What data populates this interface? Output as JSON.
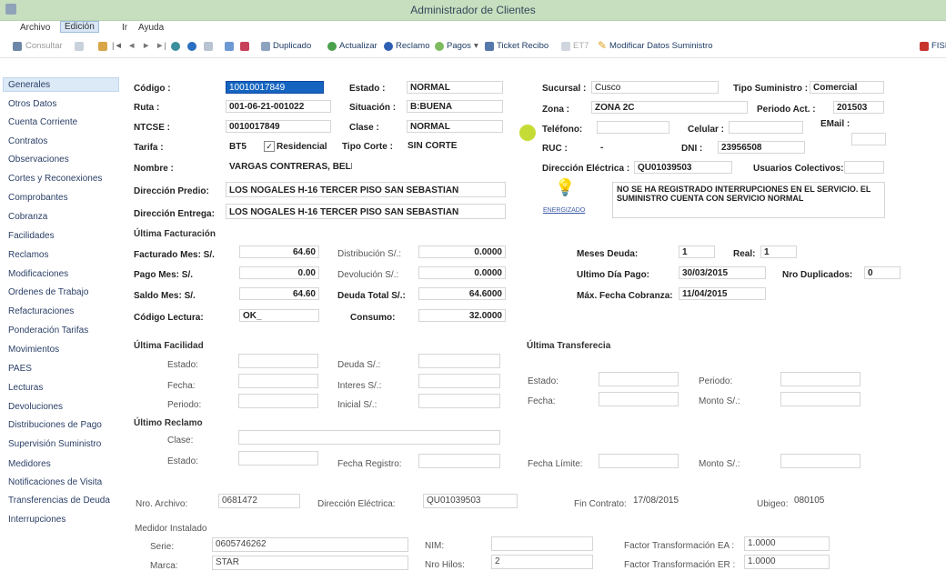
{
  "window": {
    "title": "Administrador de Clientes"
  },
  "menu": [
    "Archivo",
    "Edición",
    "Ir",
    "Ayuda"
  ],
  "toolbar": {
    "consultar": "Consultar",
    "duplicado": "Duplicado",
    "actualizar": "Actualizar",
    "reclamo": "Reclamo",
    "pagos": "Pagos",
    "ticket": "Ticket Recibo",
    "et7": "ET7",
    "modificar": "Modificar Datos Suministro",
    "fisi": "FISI"
  },
  "sidebar": [
    "Generales",
    "Otros Datos",
    "Cuenta Corriente",
    "Contratos",
    "Observaciones",
    "Cortes y Reconexiones",
    "Comprobantes",
    "Cobranza",
    "Facilidades",
    "Reclamos",
    "Modificaciones",
    "Ordenes de Trabajo",
    "Refacturaciones",
    "Ponderación Tarifas",
    "Movimientos",
    "PAES",
    "Lecturas",
    "Devoluciones",
    "Distribuciones de Pago",
    "Supervisión Suministro",
    "Medidores",
    "Notificaciones de Visita",
    "Transferencias de Deuda",
    "Interrupciones"
  ],
  "labels": {
    "codigo": "Código :",
    "ruta": "Ruta :",
    "ntcse": "NTCSE :",
    "tarifa": "Tarifa :",
    "nombre": "Nombre :",
    "dir_predio": "Dirección Predio:",
    "dir_entrega": "Dirección Entrega:",
    "estado": "Estado :",
    "situacion": "Situación :",
    "clase": "Clase :",
    "tipo_corte": "Tipo Corte :",
    "sucursal": "Sucursal :",
    "zona": "Zona :",
    "telefono": "Teléfono:",
    "ruc": "RUC :",
    "dir_electrica": "Dirección Eléctrica :",
    "tipo_suministro": "Tipo Suministro :",
    "periodo_act": "Periodo Act. :",
    "celular": "Celular :",
    "email": "EMail :",
    "dni": "DNI :",
    "usuarios": "Usuarios Colectivos:",
    "residencial": "Residencial",
    "energizado": "ENERGIZADO"
  },
  "values": {
    "codigo": "10010017849",
    "ruta": "001-06-21-001022",
    "ntcse": "0010017849",
    "tarifa": "BT5",
    "nombre": "VARGAS CONTRERAS, BELEN",
    "dir_predio": "LOS NOGALES H-16 TERCER PISO SAN SEBASTIAN",
    "dir_entrega": "LOS NOGALES H-16 TERCER PISO SAN SEBASTIAN",
    "estado": "NORMAL",
    "situacion": "B:BUENA",
    "clase": "NORMAL",
    "tipo_corte": "SIN CORTE",
    "sucursal": "Cusco",
    "zona": "ZONA 2C",
    "ruc": "-",
    "dni": "23956508",
    "dir_electrica": "QU01039503",
    "tipo_suministro": "Comercial",
    "periodo_act": "201503",
    "interrupciones": "NO SE HA REGISTRADO INTERRUPCIONES EN EL SERVICIO. EL SUMINISTRO CUENTA CON SERVICIO NORMAL"
  },
  "facturacion": {
    "title": "Última Facturación",
    "facturado_lbl": "Facturado Mes: S/.",
    "facturado": "64.60",
    "pago_lbl": "Pago Mes: S/.",
    "pago": "0.00",
    "saldo_lbl": "Saldo Mes: S/.",
    "saldo": "64.60",
    "codlect_lbl": "Código Lectura:",
    "codlect": "OK_",
    "distrib_lbl": "Distribución S/.:",
    "distrib": "0.0000",
    "devol_lbl": "Devolución S/.:",
    "devol": "0.0000",
    "deuda_lbl": "Deuda Total S/.:",
    "deuda": "64.6000",
    "consumo_lbl": "Consumo:",
    "consumo": "32.0000",
    "meses_lbl": "Meses Deuda:",
    "meses": "1",
    "real_lbl": "Real:",
    "real": "1",
    "ultimo_lbl": "Ultimo Día Pago:",
    "ultimo": "30/03/2015",
    "duplic_lbl": "Nro Duplicados:",
    "duplic": "0",
    "maxfecha_lbl": "Máx. Fecha Cobranza:",
    "maxfecha": "11/04/2015"
  },
  "facilidad": {
    "title": "Última Facilidad",
    "estado": "Estado:",
    "fecha": "Fecha:",
    "periodo": "Periodo:",
    "deuda": "Deuda S/.:",
    "interes": "Interes S/.:",
    "inicial": "Inicial S/.:"
  },
  "transferencia": {
    "title": "Última Transferecia",
    "estado": "Estado:",
    "fecha": "Fecha:",
    "periodo": "Periodo:",
    "monto": "Monto S/.:"
  },
  "reclamo": {
    "title": "Último Reclamo",
    "clase": "Clase:",
    "estado": "Estado:",
    "fecha_reg": "Fecha Registro:",
    "fecha_lim": "Fecha Límite:",
    "monto": "Monto S/.:"
  },
  "bottom": {
    "archivo_lbl": "Nro. Archivo:",
    "archivo": "0681472",
    "direlec_lbl": "Dirección Eléctrica:",
    "direlec": "QU01039503",
    "fincontrato_lbl": "Fin Contrato:",
    "fincontrato": "17/08/2015",
    "ubigeo_lbl": "Ubigeo:",
    "ubigeo": "080105",
    "medidor_title": "Medidor Instalado",
    "serie_lbl": "Serie:",
    "serie": "0605746262",
    "marca_lbl": "Marca:",
    "marca": "STAR",
    "nim_lbl": "NIM:",
    "hilos_lbl": "Nro Hilos:",
    "hilos": "2",
    "fte_lbl": "Factor Transformación EA :",
    "fte": "1.0000",
    "ftr_lbl": "Factor Transformación ER :",
    "ftr": "1.0000"
  }
}
